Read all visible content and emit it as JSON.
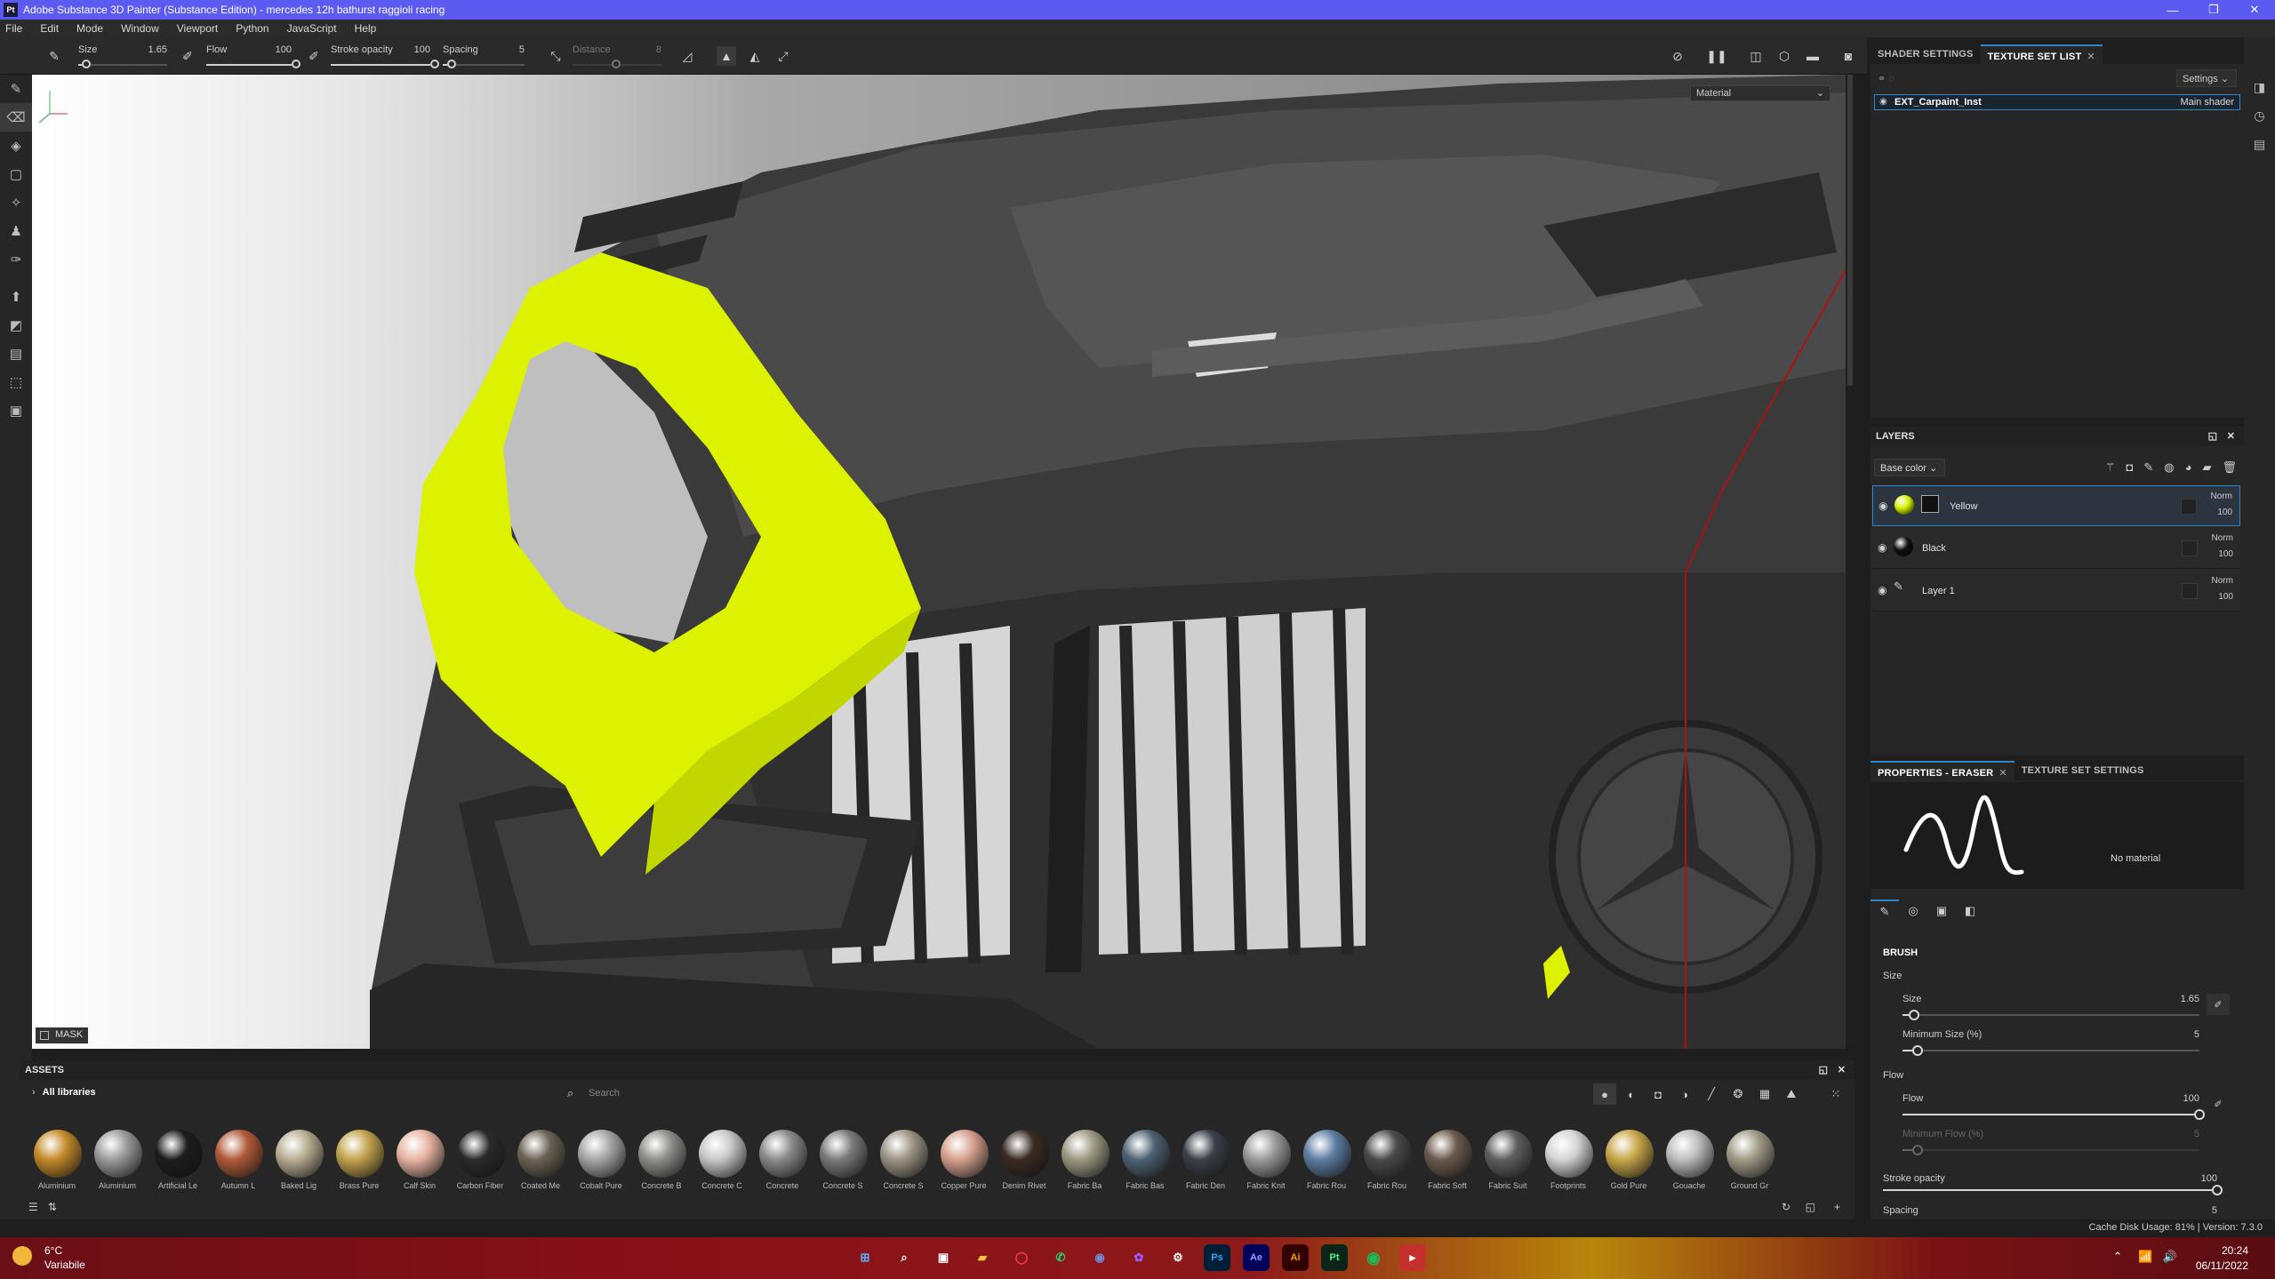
{
  "window": {
    "title": "Adobe Substance 3D Painter (Substance Edition) - mercedes 12h bathurst raggioli racing",
    "app_icon": "Pt"
  },
  "menu": [
    "File",
    "Edit",
    "Mode",
    "Window",
    "Viewport",
    "Python",
    "JavaScript",
    "Help"
  ],
  "toolbar": {
    "size_label": "Size",
    "size_value": "1.65",
    "size_level": 0.04,
    "flow_label": "Flow",
    "flow_value": "100",
    "flow_level": 1.0,
    "stroke_label": "Stroke opacity",
    "stroke_value": "100",
    "stroke_level": 1.0,
    "spacing_label": "Spacing",
    "spacing_value": "5",
    "spacing_level": 0.05,
    "distance_label": "Distance",
    "distance_value": "8"
  },
  "viewport": {
    "material_mode": "Material",
    "mask_label": "MASK",
    "gizmo_u": "U"
  },
  "texture_set": {
    "tabs": [
      "SHADER SETTINGS",
      "TEXTURE SET LIST"
    ],
    "settings_label": "Settings",
    "set_name": "EXT_Carpaint_Inst",
    "shader": "Main shader"
  },
  "layers": {
    "title": "LAYERS",
    "channel": "Base color",
    "items": [
      {
        "name": "Yellow",
        "blend": "Norm",
        "opacity": "100",
        "color": "#d5f000",
        "selected": true
      },
      {
        "name": "Black",
        "blend": "Norm",
        "opacity": "100",
        "color": "#111111",
        "selected": false
      },
      {
        "name": "Layer 1",
        "blend": "Norm",
        "opacity": "100",
        "color": "#3a3a3a",
        "selected": false
      }
    ]
  },
  "properties": {
    "tabs": [
      "PROPERTIES - ERASER",
      "TEXTURE SET SETTINGS"
    ],
    "no_material": "No material",
    "section": "BRUSH",
    "size_group": "Size",
    "size_label": "Size",
    "size_value": "1.65",
    "size_level": 0.04,
    "min_size_label": "Minimum Size (%)",
    "min_size_value": "5",
    "min_size_level": 0.05,
    "flow_group": "Flow",
    "flow_label": "Flow",
    "flow_value": "100",
    "flow_level": 1.0,
    "min_flow_label": "Minimum Flow (%)",
    "min_flow_value": "5",
    "min_flow_level": 0.05,
    "stroke_label": "Stroke opacity",
    "stroke_value": "100",
    "stroke_level": 1.0,
    "spacing_label": "Spacing",
    "spacing_value": "5"
  },
  "assets": {
    "title": "ASSETS",
    "library": "All libraries",
    "search_placeholder": "Search",
    "materials": [
      {
        "label": "Aluminium",
        "color": "#c48a2a"
      },
      {
        "label": "Aluminium",
        "color": "#9a9a9a"
      },
      {
        "label": "Artificial Le",
        "color": "#1c1c1c"
      },
      {
        "label": "Autumn L",
        "color": "#b05a38"
      },
      {
        "label": "Baked Lig",
        "color": "#b8ad92"
      },
      {
        "label": "Brass Pure",
        "color": "#c2a24c"
      },
      {
        "label": "Calf Skin",
        "color": "#e8b4a2"
      },
      {
        "label": "Carbon Fiber",
        "color": "#2a2a2a"
      },
      {
        "label": "Coated Me",
        "color": "#6b6254"
      },
      {
        "label": "Cobalt Pure",
        "color": "#a6a6a6"
      },
      {
        "label": "Concrete B",
        "color": "#8e8e8a"
      },
      {
        "label": "Concrete C",
        "color": "#c8c8c8"
      },
      {
        "label": "Concrete",
        "color": "#8a8a8a"
      },
      {
        "label": "Concrete S",
        "color": "#7a7a7a"
      },
      {
        "label": "Concrete S",
        "color": "#9c9384"
      },
      {
        "label": "Copper Pure",
        "color": "#d6a08e"
      },
      {
        "label": "Denim Rivet",
        "color": "#3a2a22"
      },
      {
        "label": "Fabric Ba",
        "color": "#9c9882"
      },
      {
        "label": "Fabric Bas",
        "color": "#4e6272"
      },
      {
        "label": "Fabric Den",
        "color": "#3a4048"
      },
      {
        "label": "Fabric Knit",
        "color": "#9a9a9a"
      },
      {
        "label": "Fabric Rou",
        "color": "#5c7ca0"
      },
      {
        "label": "Fabric Rou",
        "color": "#4a4a4a"
      },
      {
        "label": "Fabric Soft",
        "color": "#6a5a4e"
      },
      {
        "label": "Fabric Suit",
        "color": "#5e5e5e"
      },
      {
        "label": "Footprints",
        "color": "#d4d4d4"
      },
      {
        "label": "Gold Pure",
        "color": "#c7a646"
      },
      {
        "label": "Gouache",
        "color": "#bdbdbd"
      },
      {
        "label": "Ground Gr",
        "color": "#a09a86"
      }
    ]
  },
  "status": {
    "text": "Cache Disk Usage:  81%  |  Version: 7.3.0"
  },
  "taskbar": {
    "temperature": "6°C",
    "weather": "Variabile",
    "time": "20:24",
    "date": "06/11/2022",
    "apps": [
      "Ps",
      "Ae",
      "Ai",
      "Pt"
    ]
  }
}
